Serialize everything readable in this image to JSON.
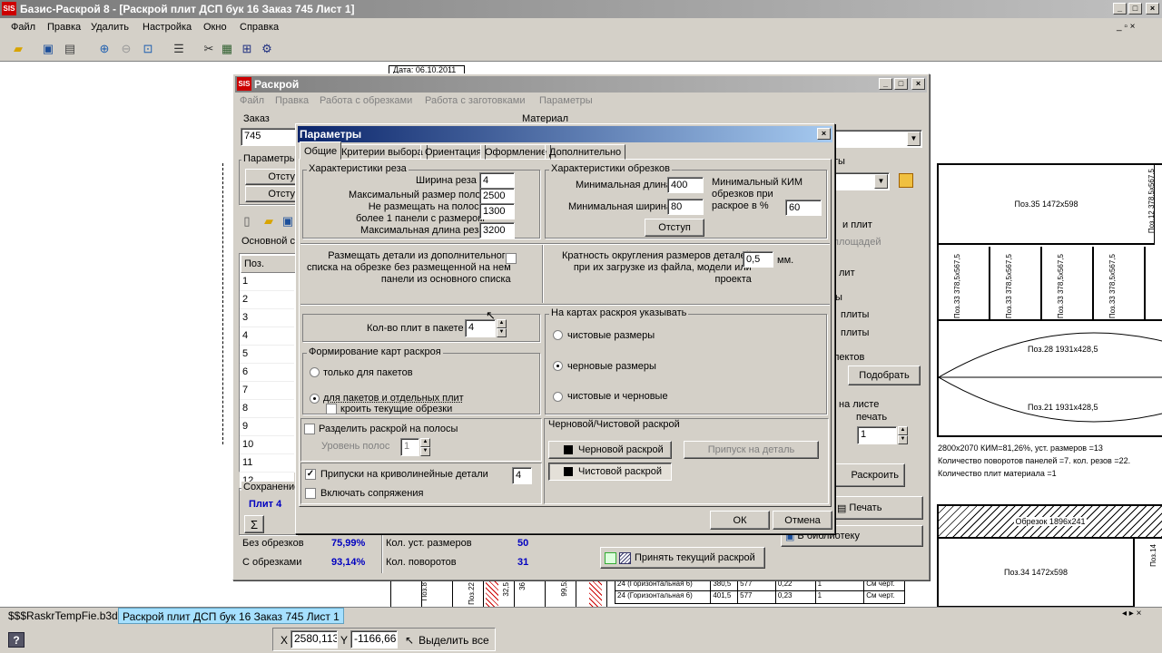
{
  "app": {
    "title": "Базис-Раскрой 8 - [Раскрой плит ДСП бук 16 Заказ 745 Лист 1]",
    "logo": "SIS",
    "menu": [
      "Файл",
      "Правка",
      "Удалить",
      "Настройка",
      "Окно",
      "Справка"
    ]
  },
  "background_drawing": {
    "date_label": "Дата: 06.10.2011",
    "pieces": [
      "Поз.35  1472x598",
      "Поз.12  378,5x567,5",
      "Поз.33  378,5x567,5",
      "Поз.28  1931x428,5",
      "Поз.21  1931x428,5",
      "Обрезок  1896x241",
      "Поз.34  1472x598",
      "Поз.14"
    ],
    "summary": [
      "2800x2070  КИМ=81,26%,  уст. размеров =13",
      "Количество поворотов панелей =7. кол. резов =22.",
      "Количество плит материала =1"
    ],
    "table_rows": [
      {
        "name": "24 (Горизонтальная 6)",
        "a": "380,5",
        "b": "577",
        "c": "0,22",
        "d": "1",
        "e": "См черт."
      },
      {
        "name": "24 (Горизонтальная 6)",
        "a": "401,5",
        "b": "577",
        "c": "0,23",
        "d": "1",
        "e": "См черт."
      }
    ],
    "left_labels": [
      "Поз.8",
      "Поз.22",
      "32,5",
      "36",
      "99,5х"
    ]
  },
  "raskroy": {
    "title": "Раскрой",
    "menu": [
      "Файл",
      "Правка",
      "Работа с обрезками",
      "Работа с заготовками",
      "Параметры"
    ],
    "order_label": "Заказ",
    "order_value": "745",
    "material_label": "Материал",
    "params_label": "Параметры",
    "buttons_left": [
      "Отсту",
      "Отсту"
    ],
    "main_sp_label": "Основной сп",
    "pos_header": "Поз.",
    "rows": [
      "1",
      "2",
      "3",
      "4",
      "5",
      "6",
      "7",
      "8",
      "9",
      "10",
      "11",
      "12"
    ],
    "save_label": "Сохранение",
    "plit_label": "Плит  4",
    "sum_icon": "Σ",
    "stats": [
      {
        "label": "Без обрезков",
        "value": "75,99%"
      },
      {
        "label": "С обрезками",
        "value": "93,14%"
      }
    ],
    "stats2": [
      {
        "label": "Кол. уст. размеров",
        "value": "50"
      },
      {
        "label": "Кол. поворотов",
        "value": "31"
      }
    ],
    "accept_button": "Принять текущий раскрой",
    "right_labels": {
      "ty": "ты",
      "and_plit": "и плит",
      "ploshadey": "площадей",
      "lit": "лит",
      "y": "ы",
      "plity": "плиты",
      "plity2": "плиты",
      "lektov": "лектов",
      "podobrat": "Подобрать",
      "na_liste": "на листе",
      "pechat_lbl": "печать",
      "pechat_value": "1",
      "raskroit": "Раскроить",
      "print": "Печать",
      "library": "В библиотеку"
    }
  },
  "dialog": {
    "title": "Параметры",
    "tabs": [
      "Общие",
      "Критерии выбора",
      "Ориентация",
      "Оформление",
      "Дополнительно"
    ],
    "cut": {
      "title": "Характеристики реза",
      "fields": [
        {
          "label": "Ширина реза",
          "value": "4"
        },
        {
          "label": "Максимальный размер полос",
          "value": "2500"
        },
        {
          "label": "Не размещать на полосе\nболее 1 панели с размером",
          "value": "1300"
        },
        {
          "label": "Максимальная длина реза",
          "value": "3200"
        }
      ]
    },
    "offcuts": {
      "title": "Характеристики обрезков",
      "min_length_label": "Минимальная длина",
      "min_length_value": "400",
      "min_width_label": "Минимальная ширина",
      "min_width_value": "80",
      "kim_label": "Минимальный КИМ\nобрезков при\nраскрое в %",
      "kim_value": "60",
      "indent_button": "Отступ"
    },
    "extra_list_label": "Размещать детали из дополнительного\nсписка на обрезке без размещенной на нем\nпанели из основного списка",
    "rounding_label": "Кратность округления размеров деталей\nпри их загрузке  из файла, модели или\nпроекта",
    "rounding_value": "0,5",
    "rounding_unit": "мм.",
    "packet_label": "Кол-во плит в пакете",
    "packet_value": "4",
    "forming": {
      "title": "Формирование карт раскроя",
      "opt1": "только для пакетов",
      "opt2": "для пакетов и отдельных плит",
      "sub": "кроить текущие обрезки"
    },
    "split_label": "Разделить раскрой на полосы",
    "level_label": "Уровень полос",
    "level_value": "1",
    "allowance_label": "Припуски на криволинейные детали",
    "allowance_value": "4",
    "mates_label": "Включать сопряжения",
    "maps": {
      "title": "На картах раскроя указывать",
      "opt1": "чистовые размеры",
      "opt2": "черновые размеры",
      "opt3": "чистовые и черновые"
    },
    "rough": {
      "title": "Черновой/Чистовой раскрой",
      "btn1": "Черновой раскрой",
      "btn2": "Чистовой раскрой",
      "btn3": "Припуск на деталь"
    },
    "ok": "ОК",
    "cancel": "Отмена"
  },
  "taskbar": {
    "tabs": [
      "$$$RaskrTempFie.b3d",
      "Раскрой плит ДСП бук 16 Заказ 745 Лист 1"
    ]
  },
  "status": {
    "x_label": "X",
    "x_value": "2580,113",
    "y_label": "Y",
    "y_value": "-1166,66",
    "select_all": "Выделить все"
  },
  "colors": {
    "title_active": "#0a246a",
    "title_active_end": "#a6caf0",
    "title_inactive": "#808080",
    "stat_value": "#0000c0"
  }
}
